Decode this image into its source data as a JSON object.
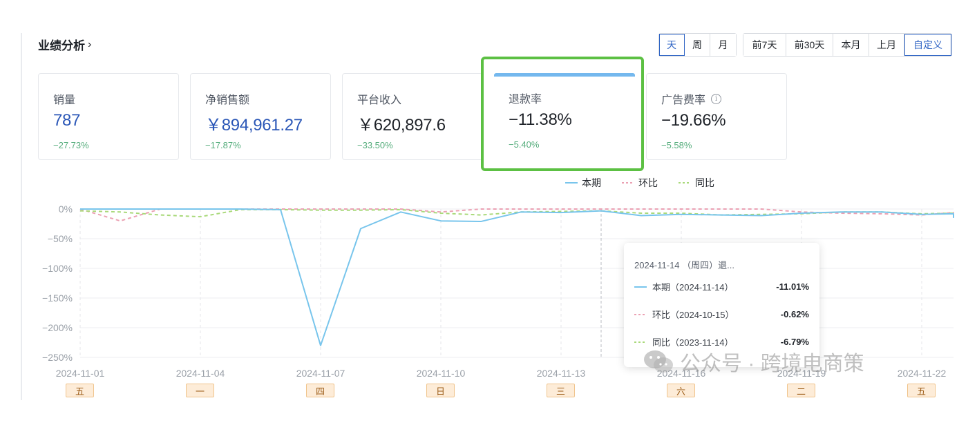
{
  "header": {
    "title": "业绩分析",
    "title_chevron": "›"
  },
  "unit_toggle": {
    "items": [
      "天",
      "周",
      "月"
    ],
    "selected": "天"
  },
  "range_toggle": {
    "items": [
      "前7天",
      "前30天",
      "本月",
      "上月",
      "自定义"
    ],
    "selected": "自定义"
  },
  "metrics": [
    {
      "label": "销量",
      "value": "787",
      "delta": "−27.73%",
      "blue": true
    },
    {
      "label": "净销售额",
      "value": "￥894,961.27",
      "delta": "−17.87%",
      "blue": true
    },
    {
      "label": "平台收入",
      "value": "￥620,897.6",
      "delta": "−33.50%",
      "blue": false
    },
    {
      "label": "退款率",
      "value": "−11.38%",
      "delta": "−5.40%",
      "blue": false,
      "selected": true
    },
    {
      "label": "广告费率",
      "value": "−19.66%",
      "delta": "−5.58%",
      "blue": false,
      "info_icon": "i"
    }
  ],
  "colors": {
    "current": "#78c5ec",
    "mom": "#eba1b3",
    "yoy": "#a9d97a",
    "highlight": "#5cc043",
    "accent": "#2f64c4",
    "delta_green": "#55ad7c"
  },
  "chart_data": {
    "type": "line",
    "x": [
      "2024-11-01",
      "2024-11-02",
      "2024-11-03",
      "2024-11-04",
      "2024-11-05",
      "2024-11-06",
      "2024-11-07",
      "2024-11-08",
      "2024-11-09",
      "2024-11-10",
      "2024-11-11",
      "2024-11-12",
      "2024-11-13",
      "2024-11-14",
      "2024-11-15",
      "2024-11-16",
      "2024-11-17",
      "2024-11-18",
      "2024-11-19",
      "2024-11-20",
      "2024-11-21",
      "2024-11-22",
      "2024-11-23"
    ],
    "x_tick_labels": [
      "2024-11-01",
      "2024-11-04",
      "2024-11-07",
      "2024-11-10",
      "2024-11-13",
      "2024-11-16",
      "2024-11-19",
      "2024-11-22"
    ],
    "y_ticks": [
      "0%",
      "−50%",
      "−100%",
      "−150%",
      "−200%",
      "−250%"
    ],
    "ylim": [
      -250,
      0
    ],
    "series": [
      {
        "name": "本期",
        "style": "solid",
        "values": [
          0,
          0,
          0,
          0,
          0,
          -1,
          -230,
          -33,
          -5,
          -20,
          -21,
          -5,
          -6,
          -3,
          -11,
          -9,
          -10,
          -11,
          -7,
          -5,
          -5,
          -9,
          -8,
          -15
        ]
      },
      {
        "name": "环比",
        "style": "dashed",
        "values": [
          0,
          -20,
          0,
          0,
          0,
          0,
          0,
          0,
          0,
          -5,
          0,
          0,
          0,
          0,
          0,
          0,
          0,
          0,
          -5,
          -7,
          -8,
          -10,
          -6,
          -5
        ]
      },
      {
        "name": "同比",
        "style": "dashed",
        "values": [
          -3,
          -5,
          -10,
          -13,
          -1,
          -1,
          -2,
          -2,
          -1,
          -7,
          -10,
          -5,
          -4,
          -3,
          -7,
          -7,
          -10,
          -9,
          -8,
          -5,
          -5,
          -8,
          -7,
          -6
        ]
      }
    ],
    "legend": [
      "本期",
      "环比",
      "同比"
    ],
    "legend_position": "top-center"
  },
  "weekday_badges": [
    "五",
    "一",
    "四",
    "日",
    "三",
    "六",
    "二",
    "五"
  ],
  "tooltip": {
    "title": "2024-11-14 （周四）退...",
    "rows": [
      {
        "label": "本期（2024-11-14）",
        "value": "-11.01%",
        "style": "solid"
      },
      {
        "label": "环比（2024-10-15）",
        "value": "-0.62%",
        "style": "dashed-pink"
      },
      {
        "label": "同比（2023-11-14）",
        "value": "-6.79%",
        "style": "dashed-green"
      }
    ]
  },
  "watermark": {
    "text": "公众号 · 跨境电商策"
  }
}
